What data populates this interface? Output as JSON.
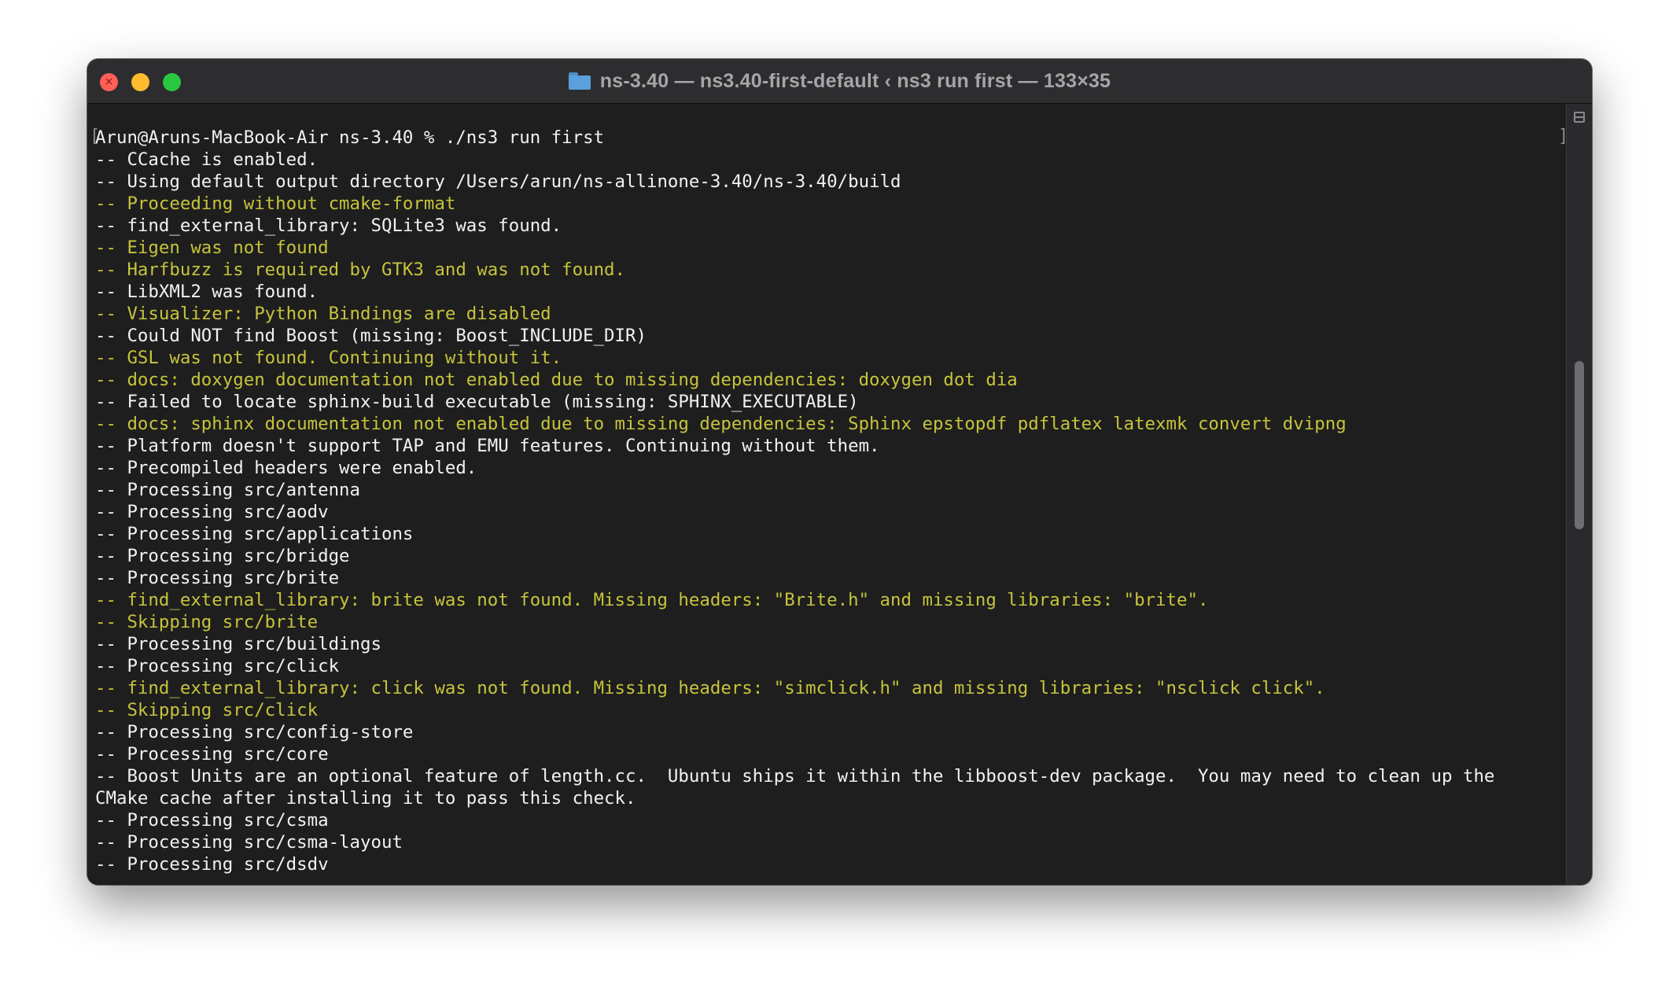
{
  "window": {
    "title": "ns-3.40 — ns3.40-first-default ‹ ns3 run first — 133×35"
  },
  "terminal": {
    "lines": [
      {
        "text": "Arun@Aruns-MacBook-Air ns-3.40 % ./ns3 run first",
        "color": "white"
      },
      {
        "text": "-- CCache is enabled.",
        "color": "white"
      },
      {
        "text": "-- Using default output directory /Users/arun/ns-allinone-3.40/ns-3.40/build",
        "color": "white"
      },
      {
        "text": "-- Proceeding without cmake-format",
        "color": "yellow"
      },
      {
        "text": "-- find_external_library: SQLite3 was found.",
        "color": "white"
      },
      {
        "text": "-- Eigen was not found",
        "color": "yellow"
      },
      {
        "text": "-- Harfbuzz is required by GTK3 and was not found.",
        "color": "yellow"
      },
      {
        "text": "-- LibXML2 was found.",
        "color": "white"
      },
      {
        "text": "-- Visualizer: Python Bindings are disabled",
        "color": "yellow"
      },
      {
        "text": "-- Could NOT find Boost (missing: Boost_INCLUDE_DIR)",
        "color": "white"
      },
      {
        "text": "-- GSL was not found. Continuing without it.",
        "color": "yellow"
      },
      {
        "text": "-- docs: doxygen documentation not enabled due to missing dependencies: doxygen dot dia",
        "color": "yellow"
      },
      {
        "text": "-- Failed to locate sphinx-build executable (missing: SPHINX_EXECUTABLE)",
        "color": "white"
      },
      {
        "text": "-- docs: sphinx documentation not enabled due to missing dependencies: Sphinx epstopdf pdflatex latexmk convert dvipng",
        "color": "yellow"
      },
      {
        "text": "-- Platform doesn't support TAP and EMU features. Continuing without them.",
        "color": "white"
      },
      {
        "text": "-- Precompiled headers were enabled.",
        "color": "white"
      },
      {
        "text": "-- Processing src/antenna",
        "color": "white"
      },
      {
        "text": "-- Processing src/aodv",
        "color": "white"
      },
      {
        "text": "-- Processing src/applications",
        "color": "white"
      },
      {
        "text": "-- Processing src/bridge",
        "color": "white"
      },
      {
        "text": "-- Processing src/brite",
        "color": "white"
      },
      {
        "text": "-- find_external_library: brite was not found. Missing headers: \"Brite.h\" and missing libraries: \"brite\".",
        "color": "yellow"
      },
      {
        "text": "-- Skipping src/brite",
        "color": "yellow"
      },
      {
        "text": "-- Processing src/buildings",
        "color": "white"
      },
      {
        "text": "-- Processing src/click",
        "color": "white"
      },
      {
        "text": "-- find_external_library: click was not found. Missing headers: \"simclick.h\" and missing libraries: \"nsclick click\".",
        "color": "yellow"
      },
      {
        "text": "-- Skipping src/click",
        "color": "yellow"
      },
      {
        "text": "-- Processing src/config-store",
        "color": "white"
      },
      {
        "text": "-- Processing src/core",
        "color": "white"
      },
      {
        "text": "-- Boost Units are an optional feature of length.cc.  Ubuntu ships it within the libboost-dev package.  You may need to clean up the",
        "color": "white"
      },
      {
        "text": "CMake cache after installing it to pass this check.",
        "color": "white"
      },
      {
        "text": "-- Processing src/csma",
        "color": "white"
      },
      {
        "text": "-- Processing src/csma-layout",
        "color": "white"
      },
      {
        "text": "-- Processing src/dsdv",
        "color": "white"
      }
    ]
  },
  "colors": {
    "output_white": "#f2f2f2",
    "output_yellow": "#c6c43c",
    "background": "#1e1e1e"
  },
  "icons": {
    "title_icon": "folder-icon",
    "split_pane": "split-pane-icon"
  }
}
